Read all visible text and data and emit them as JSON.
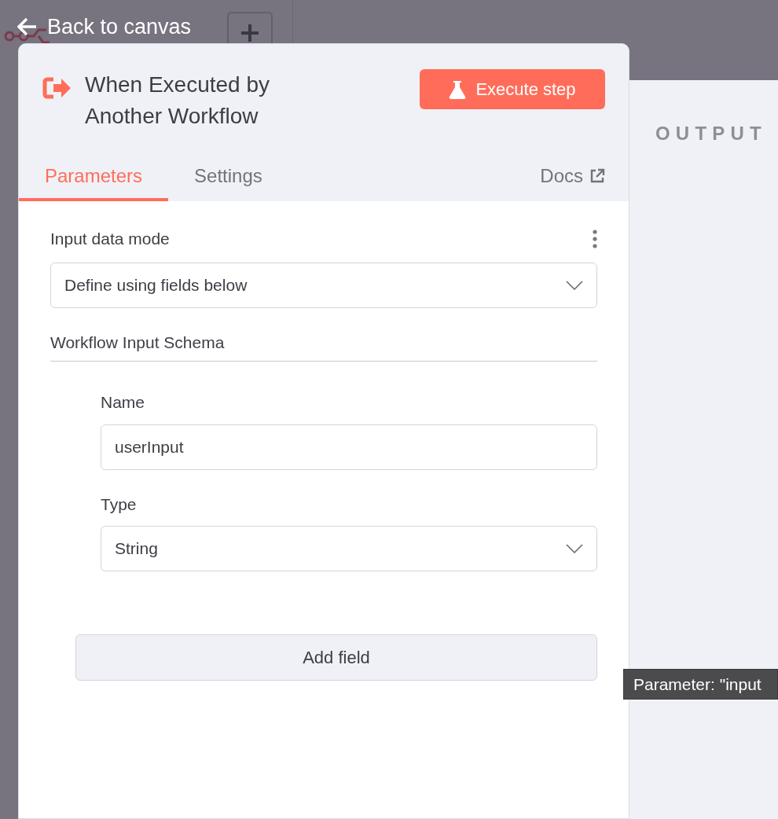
{
  "back_link": {
    "label": "Back to canvas"
  },
  "node": {
    "title": "When Executed by Another Workflow",
    "execute_button": "Execute step"
  },
  "tabs": [
    {
      "label": "Parameters",
      "selected": true
    },
    {
      "label": "Settings",
      "selected": false
    }
  ],
  "docs_link": "Docs",
  "parameters": {
    "input_data_mode": {
      "label": "Input data mode",
      "value": "Define using fields below"
    },
    "schema_title": "Workflow Input Schema",
    "fields": [
      {
        "kind": "text",
        "label": "Name",
        "value": "userInput"
      },
      {
        "kind": "select",
        "label": "Type",
        "value": "String"
      }
    ],
    "add_button": "Add field"
  },
  "output_panel": {
    "title": "OUTPUT"
  },
  "tooltip": "Parameter: \"input"
}
